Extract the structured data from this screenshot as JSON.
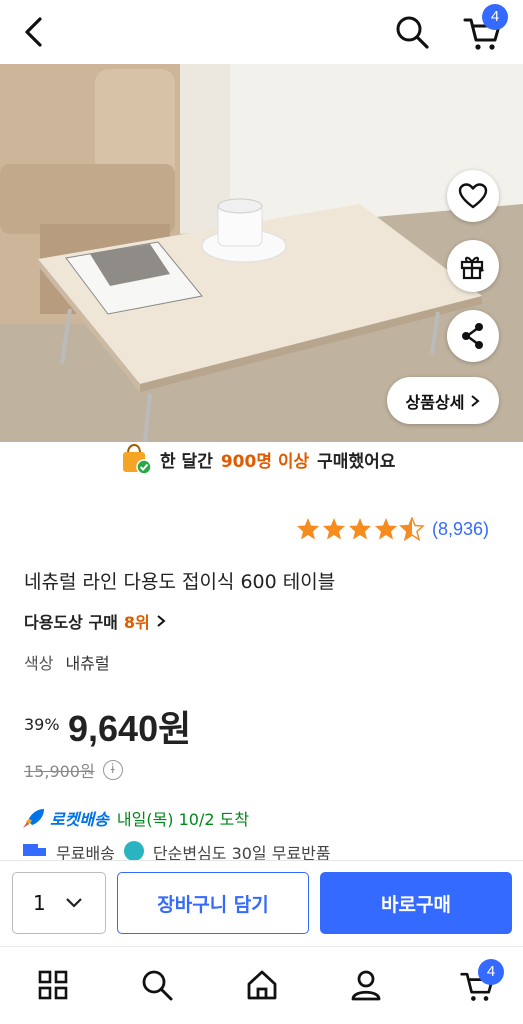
{
  "header": {
    "back_icon": "chevron-left-icon",
    "search_icon": "search-icon",
    "cart_icon": "cart-icon",
    "cart_count": "4"
  },
  "gallery": {
    "image": "photo of folding table with cup and book on rug beside sofa",
    "slide_count": 6,
    "active_index": 0,
    "detail_button": "상품상세"
  },
  "actions": {
    "wishlist_icon": "heart-icon",
    "gift_icon": "gift-icon",
    "share_icon": "share-icon"
  },
  "social_proof": {
    "prefix": "한 달간",
    "highlight": "900명 이상",
    "suffix": "구매했어요"
  },
  "rating": {
    "stars": 4.5,
    "count": "(8,936)"
  },
  "product": {
    "title": "네츄럴 라인 다용도 접이식 600 테이블",
    "seller_prefix": "다용도상 구매",
    "seller_rank": "8위",
    "option_label": "색상",
    "option_value": "내츄럴"
  },
  "pricing": {
    "discount": "39%",
    "price": "9,640원",
    "original": "15,900원"
  },
  "delivery": {
    "rocket_label": "로켓배송",
    "eta": "내일(목) 10/2 도착",
    "free_shipping": "무료배송",
    "returns": "단순변심도 30일 무료반품"
  },
  "purchase": {
    "quantity": "1",
    "add_to_cart": "장바구니 담기",
    "buy_now": "바로구매"
  },
  "bottom_nav": {
    "cart_count": "4"
  },
  "colors": {
    "accent": "#346aff",
    "highlight": "#e05b00",
    "rocket": "#0073e9",
    "eta": "#00891a"
  }
}
